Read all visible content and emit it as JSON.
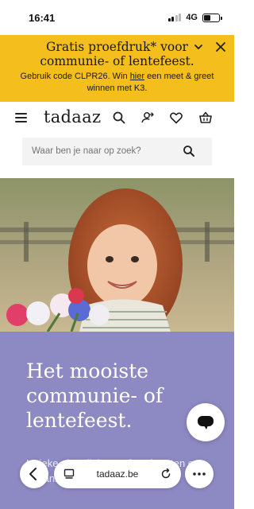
{
  "status_bar": {
    "time": "16:41",
    "network": "4G"
  },
  "promo": {
    "headline": "Gratis proefdruk* voor communie- of lentefeest.",
    "sub_before": "Gebruik code CLPR26. Win ",
    "sub_link": "hier",
    "sub_after": " een meet & greet winnen met K3."
  },
  "header": {
    "logo": "tadaaz"
  },
  "search": {
    "placeholder": "Waar ben je naar op zoek?"
  },
  "hero": {
    "title": "Het mooiste communie- of lentefeest.",
    "body": "Unieke uitnodigingen, feestkaarten en bedankjes. Ontdek nu de"
  },
  "browser": {
    "url": "tadaaz.be"
  },
  "colors": {
    "promo_bg": "#f4be1c",
    "hero_purple": "#8d89c2"
  }
}
